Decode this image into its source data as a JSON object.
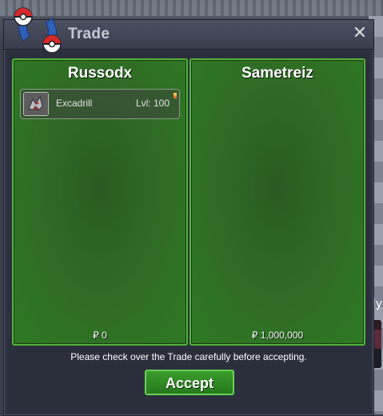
{
  "window": {
    "title": "Trade",
    "close_glyph": "✕"
  },
  "trader_left": {
    "name": "Russodx",
    "money": "₽ 0",
    "items": [
      {
        "name": "Excadrill",
        "level": "Lvl: 100",
        "icon": "excadrill-icon"
      }
    ]
  },
  "trader_right": {
    "name": "Sametreiz",
    "money": "₽ 1,000,000",
    "items": []
  },
  "notice": "Please check over the Trade carefully before accepting.",
  "accept_label": "Accept",
  "colors": {
    "panel_border": "#4fb53a",
    "panel_fill": "#2e7a24",
    "accept_fill": "#2f8a24",
    "window_bg": "#2e3240"
  }
}
